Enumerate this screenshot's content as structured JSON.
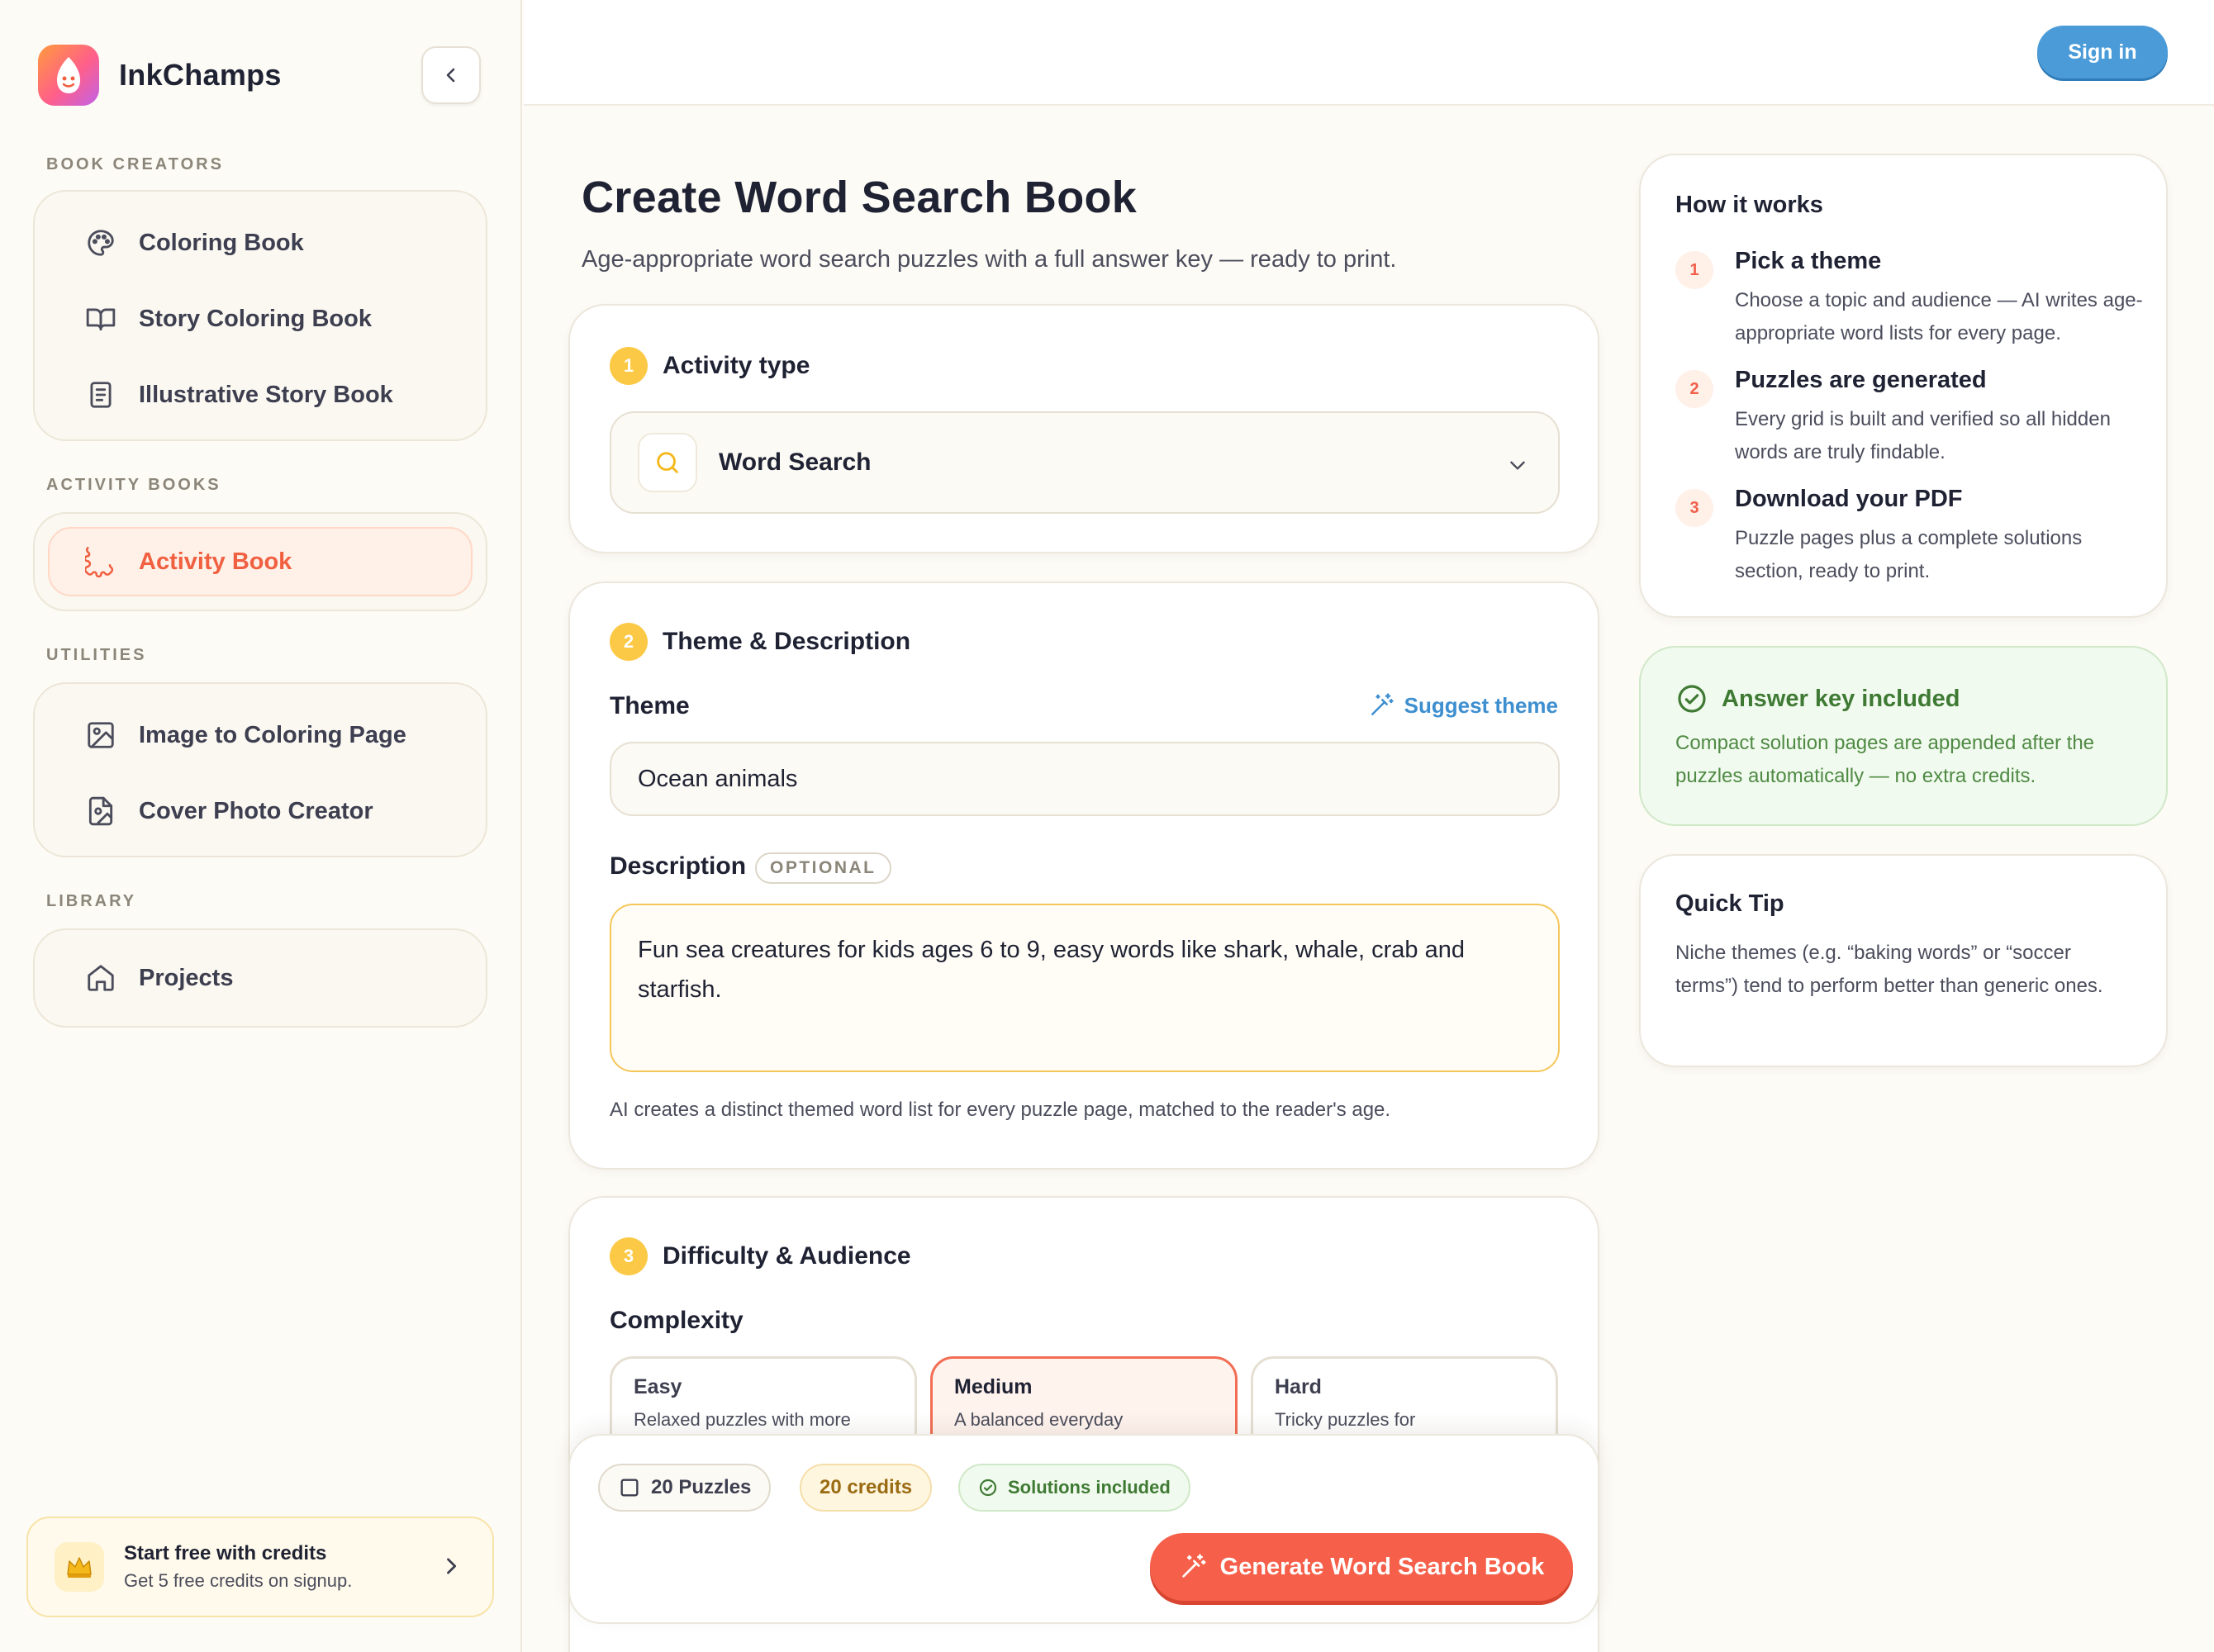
{
  "brand": {
    "name": "InkChamps"
  },
  "sidebar": {
    "sections": [
      {
        "label": "BOOK CREATORS",
        "items": [
          {
            "label": "Coloring Book",
            "icon": "palette-icon"
          },
          {
            "label": "Story Coloring Book",
            "icon": "open-book-icon"
          },
          {
            "label": "Illustrative Story Book",
            "icon": "document-icon"
          }
        ]
      },
      {
        "label": "ACTIVITY BOOKS",
        "items": [
          {
            "label": "Activity Book",
            "icon": "puzzle-icon",
            "active": true
          }
        ]
      },
      {
        "label": "UTILITIES",
        "items": [
          {
            "label": "Image to Coloring Page",
            "icon": "image-icon"
          },
          {
            "label": "Cover Photo Creator",
            "icon": "image-file-icon"
          }
        ]
      },
      {
        "label": "LIBRARY",
        "items": [
          {
            "label": "Projects",
            "icon": "home-icon"
          }
        ]
      }
    ],
    "promo": {
      "title": "Start free with credits",
      "subtitle": "Get 5 free credits on signup.",
      "icon": "crown-icon"
    }
  },
  "topbar": {
    "signin_label": "Sign in"
  },
  "main": {
    "title": "Create Word Search Book",
    "subtitle": "Age-appropriate word search puzzles with a full answer key — ready to print.",
    "step1": {
      "number": "1",
      "title": "Activity type",
      "selected": "Word Search"
    },
    "step2": {
      "number": "2",
      "title": "Theme & Description",
      "theme_label": "Theme",
      "suggest_label": "Suggest theme",
      "theme_value": "Ocean animals",
      "description_label": "Description",
      "optional_label": "OPTIONAL",
      "description_value": "Fun sea creatures for kids ages 6 to 9, easy words like shark, whale, crab and starfish.",
      "helper": "AI creates a distinct themed word list for every puzzle page, matched to the reader's age."
    },
    "step3": {
      "number": "3",
      "title": "Difficulty & Audience",
      "complexity_label": "Complexity",
      "options": [
        {
          "title": "Easy",
          "desc": "Relaxed puzzles with more"
        },
        {
          "title": "Medium",
          "desc": "A balanced everyday",
          "selected": true
        },
        {
          "title": "Hard",
          "desc": "Tricky puzzles for"
        }
      ]
    }
  },
  "action_bar": {
    "puzzles_label": "20 Puzzles",
    "credits_label": "20 credits",
    "solutions_label": "Solutions included",
    "generate_label": "Generate Word Search Book"
  },
  "right": {
    "how": {
      "title": "How it works",
      "steps": [
        {
          "num": "1",
          "title": "Pick a theme",
          "desc": "Choose a topic and audience — AI writes age-appropriate word lists for every page."
        },
        {
          "num": "2",
          "title": "Puzzles are generated",
          "desc": "Every grid is built and verified so all hidden words are truly findable."
        },
        {
          "num": "3",
          "title": "Download your PDF",
          "desc": "Puzzle pages plus a complete solutions section, ready to print."
        }
      ]
    },
    "answer": {
      "title": "Answer key included",
      "desc": "Compact solution pages are appended after the puzzles automatically — no extra credits."
    },
    "tip": {
      "title": "Quick Tip",
      "desc": "Niche themes (e.g. “baking words” or “soccer terms”) tend to perform better than generic ones."
    }
  },
  "colors": {
    "accent": "#f6604a",
    "step": "#fbc945",
    "link": "#3e8fd0",
    "signin": "#4a9bd8",
    "success": "#3f7a34"
  }
}
